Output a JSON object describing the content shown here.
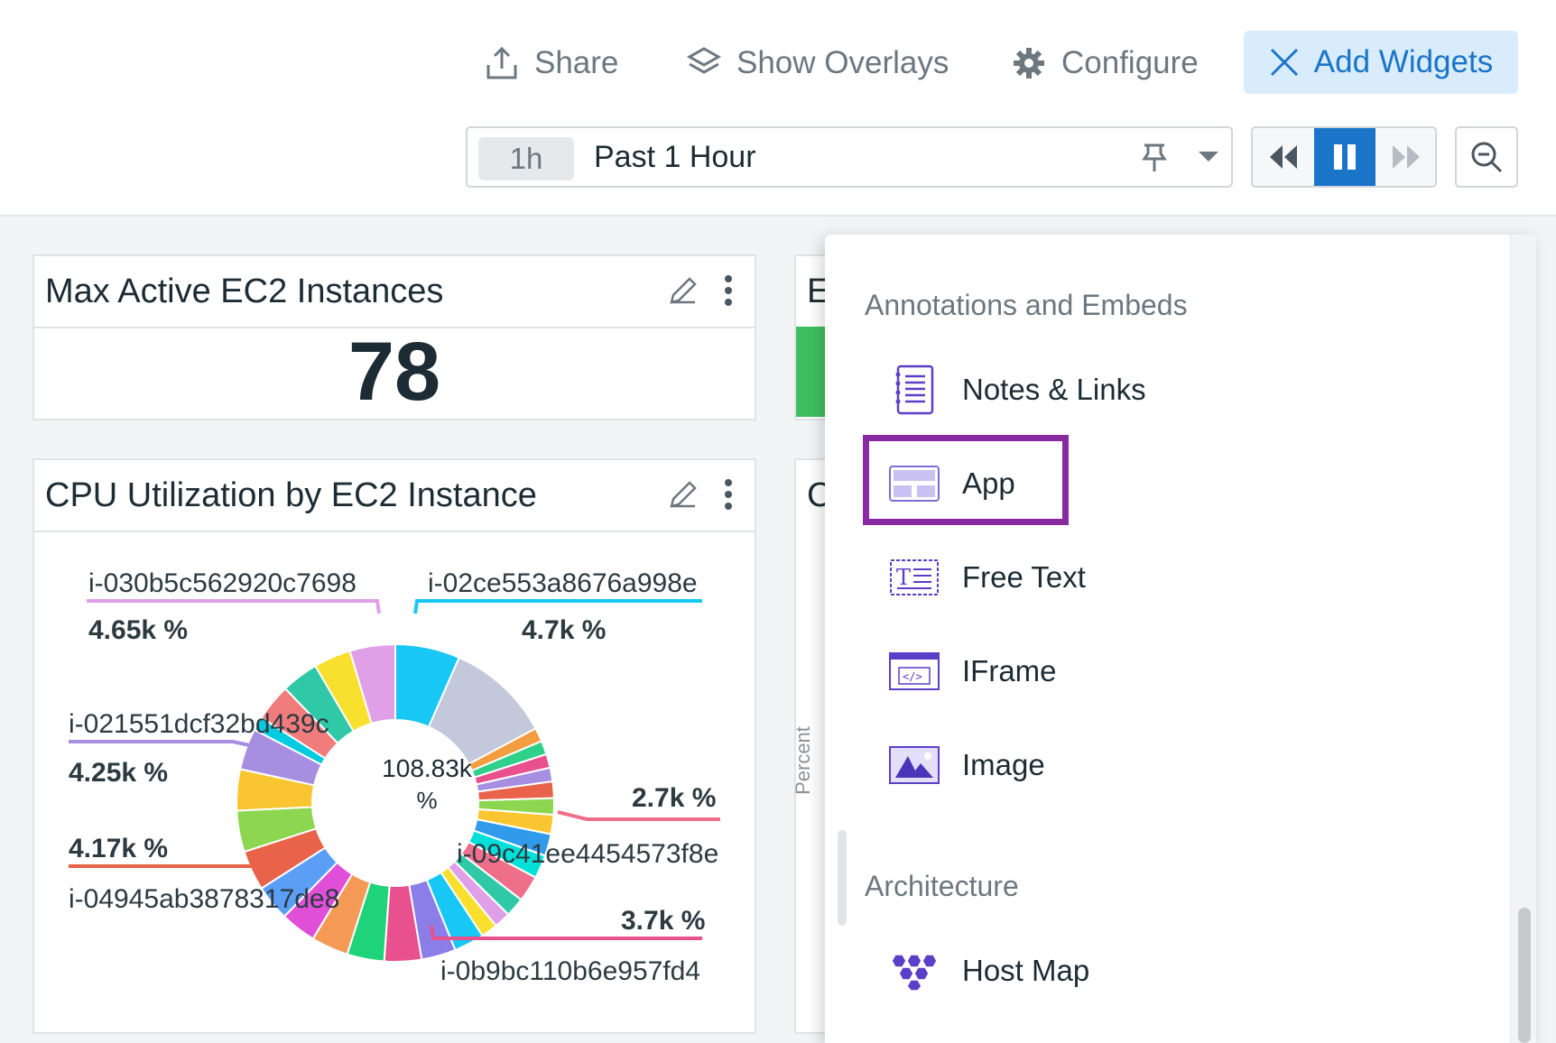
{
  "header": {
    "share_label": "Share",
    "overlays_label": "Show Overlays",
    "configure_label": "Configure",
    "add_widgets_label": "Add Widgets"
  },
  "timeframe": {
    "pill": "1h",
    "label": "Past 1 Hour"
  },
  "widgets": {
    "max_active": {
      "title": "Max Active EC2 Instances",
      "value": "78"
    },
    "cpu": {
      "title": "CPU Utilization by EC2 Instance",
      "center_value": "108.83k",
      "center_unit": "%",
      "callouts": [
        {
          "id": "i-030b5c562920c7698",
          "value": "4.65k %",
          "color": "#e0a0e8"
        },
        {
          "id": "i-02ce553a8676a998e",
          "value": "4.7k %",
          "color": "#18c7f4"
        },
        {
          "id": "i-021551dcf32bd439c",
          "value": "4.25k %",
          "color": "#a78ee0"
        },
        {
          "id": "i-09c41ee4454573f8e",
          "value": "2.7k %",
          "color": "#ef6f8a"
        },
        {
          "id": "i-04945ab3878317de8",
          "value": "4.17k %",
          "color": "#e8634a"
        },
        {
          "id": "i-0b9bc110b6e957fd4",
          "value": "3.7k %",
          "color": "#e8508e"
        }
      ]
    },
    "partial_top_letter": "E",
    "partial_mid_letter": "C",
    "partial_axis_label": "Percent"
  },
  "panel": {
    "section1": "Annotations and Embeds",
    "items1": [
      {
        "label": "Notes & Links",
        "icon": "notes-icon"
      },
      {
        "label": "App",
        "icon": "app-icon"
      },
      {
        "label": "Free Text",
        "icon": "free-text-icon"
      },
      {
        "label": "IFrame",
        "icon": "iframe-icon"
      },
      {
        "label": "Image",
        "icon": "image-icon"
      }
    ],
    "section2": "Architecture",
    "items2": [
      {
        "label": "Host Map",
        "icon": "host-map-icon"
      }
    ]
  },
  "colors": {
    "accent": "#1a75c9",
    "highlight": "#8a2aa3",
    "icon_purple": "#5a3fc8"
  }
}
